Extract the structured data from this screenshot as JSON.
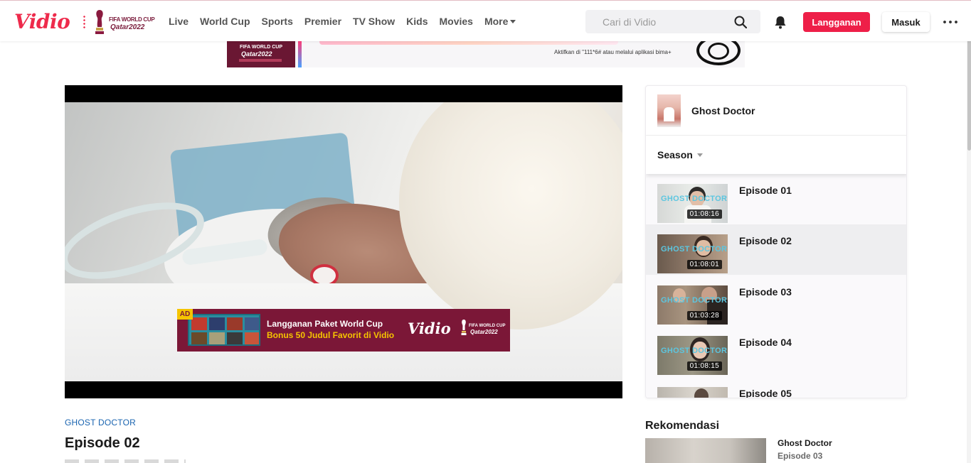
{
  "header": {
    "logo": "Vidio",
    "worldcup_line1": "FIFA WORLD CUP",
    "worldcup_line2": "Qatar2022",
    "nav": [
      "Live",
      "World Cup",
      "Sports",
      "Premier",
      "TV Show",
      "Kids",
      "Movies"
    ],
    "nav_more": "More",
    "search_placeholder": "Cari di Vidio",
    "subscribe_label": "Langganan",
    "login_label": "Masuk",
    "icons": {
      "search": "search-icon",
      "notification": "bell-icon",
      "menu": "more-dots-icon"
    },
    "accent_color": "#ee1f48"
  },
  "top_banner": {
    "line1": "FIFA WORLD CUP",
    "line2": "Qatar2022",
    "info": "Aktifkan di \"111*6# atau melalui aplikasi bima+"
  },
  "player": {
    "ad": {
      "badge": "AD",
      "line1": "Langganan Paket World Cup",
      "line2": "Bonus 50 Judul Favorit di Vidio",
      "logo": "Vidio",
      "wc_line1": "FIFA WORLD CUP",
      "wc_line2": "Qatar2022"
    }
  },
  "video_info": {
    "show_link": "GHOST DOCTOR",
    "episode_title": "Episode 02"
  },
  "sidebar": {
    "show_name": "Ghost Doctor",
    "season_label": "Season",
    "episodes": [
      {
        "name": "Episode 01",
        "duration": "01:08:16",
        "active": false
      },
      {
        "name": "Episode 02",
        "duration": "01:08:01",
        "active": true
      },
      {
        "name": "Episode 03",
        "duration": "01:03:28",
        "active": false
      },
      {
        "name": "Episode 04",
        "duration": "01:08:15",
        "active": false
      },
      {
        "name": "Episode 05",
        "duration": "",
        "active": false
      }
    ],
    "thumb_logo": "GHOST DOCTOR"
  },
  "rekomendasi": {
    "title": "Rekomendasi",
    "items": [
      {
        "title": "Ghost Doctor",
        "subtitle": "Episode 03"
      }
    ]
  }
}
